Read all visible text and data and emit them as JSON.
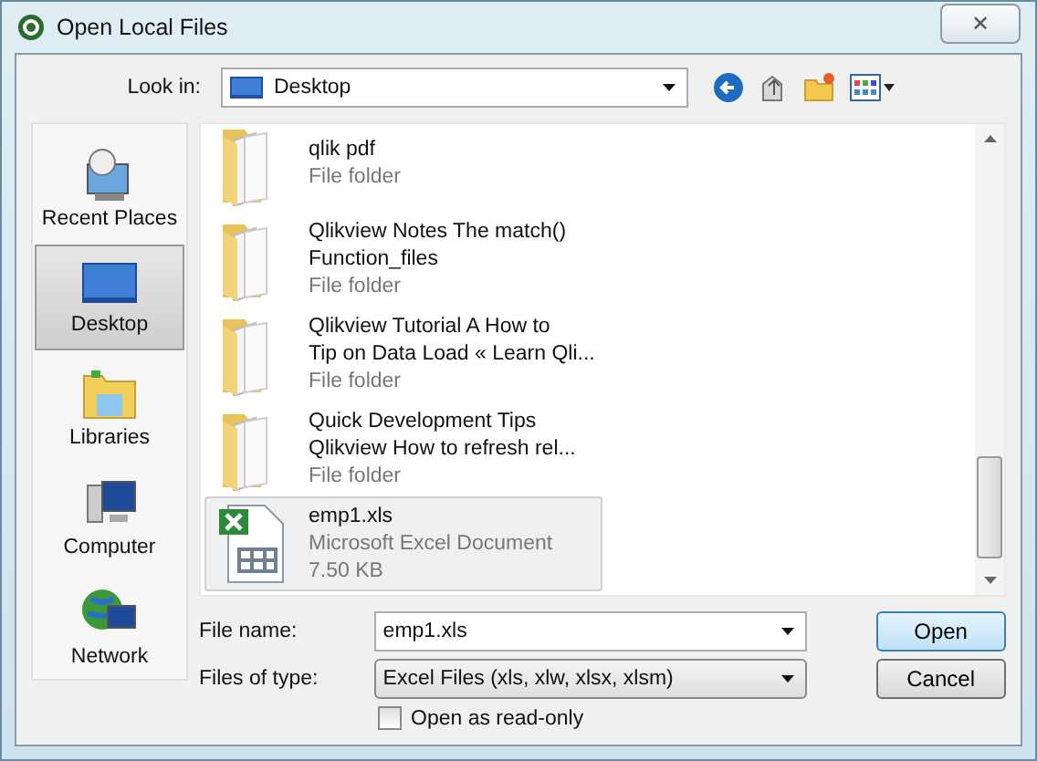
{
  "window": {
    "title": "Open Local Files",
    "close": "✕"
  },
  "look_in": {
    "label": "Look in:",
    "value": "Desktop"
  },
  "places": [
    {
      "label": "Recent Places",
      "kind": "recent",
      "selected": false
    },
    {
      "label": "Desktop",
      "kind": "desktop",
      "selected": true
    },
    {
      "label": "Libraries",
      "kind": "libraries",
      "selected": false
    },
    {
      "label": "Computer",
      "kind": "computer",
      "selected": false
    },
    {
      "label": "Network",
      "kind": "network",
      "selected": false
    }
  ],
  "files": [
    {
      "kind": "folder",
      "name": [
        "qlik pdf"
      ],
      "details": [
        "File folder"
      ],
      "selected": false
    },
    {
      "kind": "folder",
      "name": [
        "Qlikview Notes  The match()",
        "Function_files"
      ],
      "details": [
        "File folder"
      ],
      "selected": false
    },
    {
      "kind": "folder",
      "name": [
        "Qlikview Tutorial  A How to",
        "Tip on Data Load « Learn Qli..."
      ],
      "details": [
        "File folder"
      ],
      "selected": false
    },
    {
      "kind": "folder",
      "name": [
        "Quick Development Tips",
        "Qlikview  How to refresh rel..."
      ],
      "details": [
        "File folder"
      ],
      "selected": false
    },
    {
      "kind": "excel",
      "name": [
        "emp1.xls"
      ],
      "details": [
        "Microsoft Excel Document",
        "7.50 KB"
      ],
      "selected": true
    }
  ],
  "file_name": {
    "label": "File name:",
    "value": "emp1.xls"
  },
  "file_type": {
    "label": "Files of type:",
    "value": "Excel Files (xls, xlw, xlsx, xlsm)"
  },
  "read_only": {
    "label": "Open as read-only",
    "checked": false
  },
  "buttons": [
    {
      "label": "Open",
      "kind": "primary"
    },
    {
      "label": "Cancel",
      "kind": "normal"
    }
  ]
}
